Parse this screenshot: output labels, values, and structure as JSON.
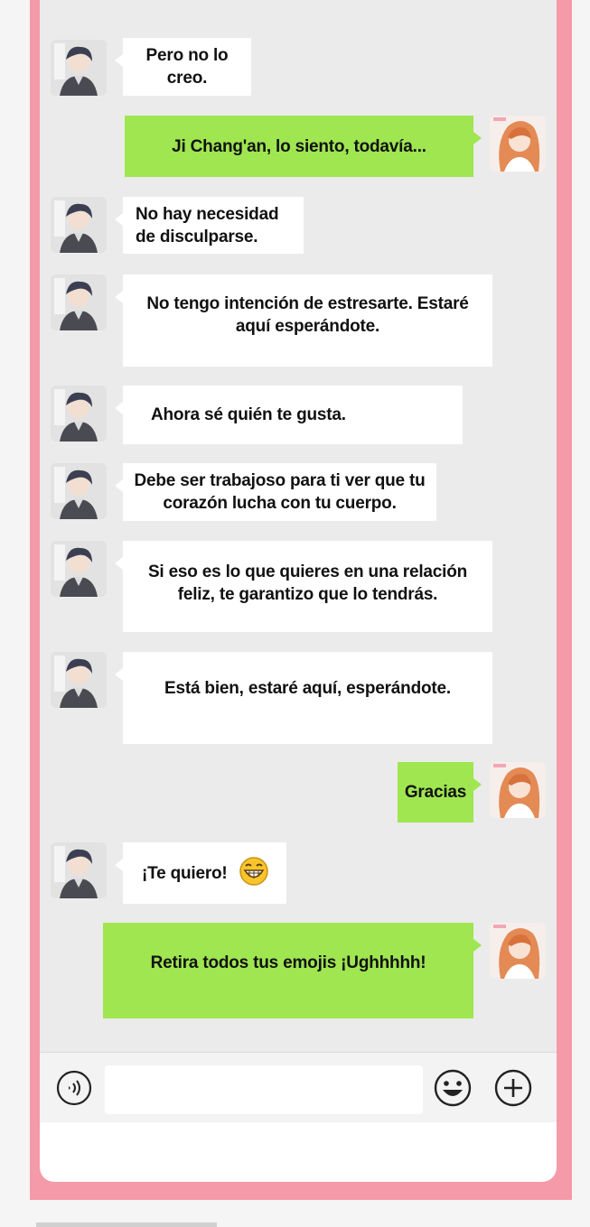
{
  "chat": {
    "messages": [
      {
        "side": "in",
        "text": "Pero no lo\ncreo."
      },
      {
        "side": "out",
        "text": "Ji Chang'an, lo siento, todavía..."
      },
      {
        "side": "in",
        "text": "No hay necesidad\nde disculparse."
      },
      {
        "side": "in",
        "text": "No tengo intención de estresarte. Estaré\naquí esperándote."
      },
      {
        "side": "in",
        "text": "Ahora sé quién te gusta."
      },
      {
        "side": "in",
        "text": "Debe ser trabajoso para ti ver que tu\ncorazón lucha con tu cuerpo."
      },
      {
        "side": "in",
        "text": "Si eso es lo que quieres en una relación\nfeliz, te garantizo que lo tendrás."
      },
      {
        "side": "in",
        "text": "Está bien, estaré aquí, esperándote."
      },
      {
        "side": "out",
        "text": "Gracias"
      },
      {
        "side": "in",
        "text": "¡Te quiero!",
        "emoji": "grinning-face-emoji"
      },
      {
        "side": "out",
        "text": "Retira todos tus emojis ¡Ughhhhh!"
      }
    ]
  },
  "input_bar": {
    "voice_icon": "voice-icon",
    "message_value": "",
    "emoji_icon": "smiley-icon",
    "add_icon": "plus-icon"
  },
  "colors": {
    "frame": "#f59aa8",
    "chat_background": "#ebebeb",
    "incoming_bubble": "#ffffff",
    "outgoing_bubble": "#9fe651"
  }
}
